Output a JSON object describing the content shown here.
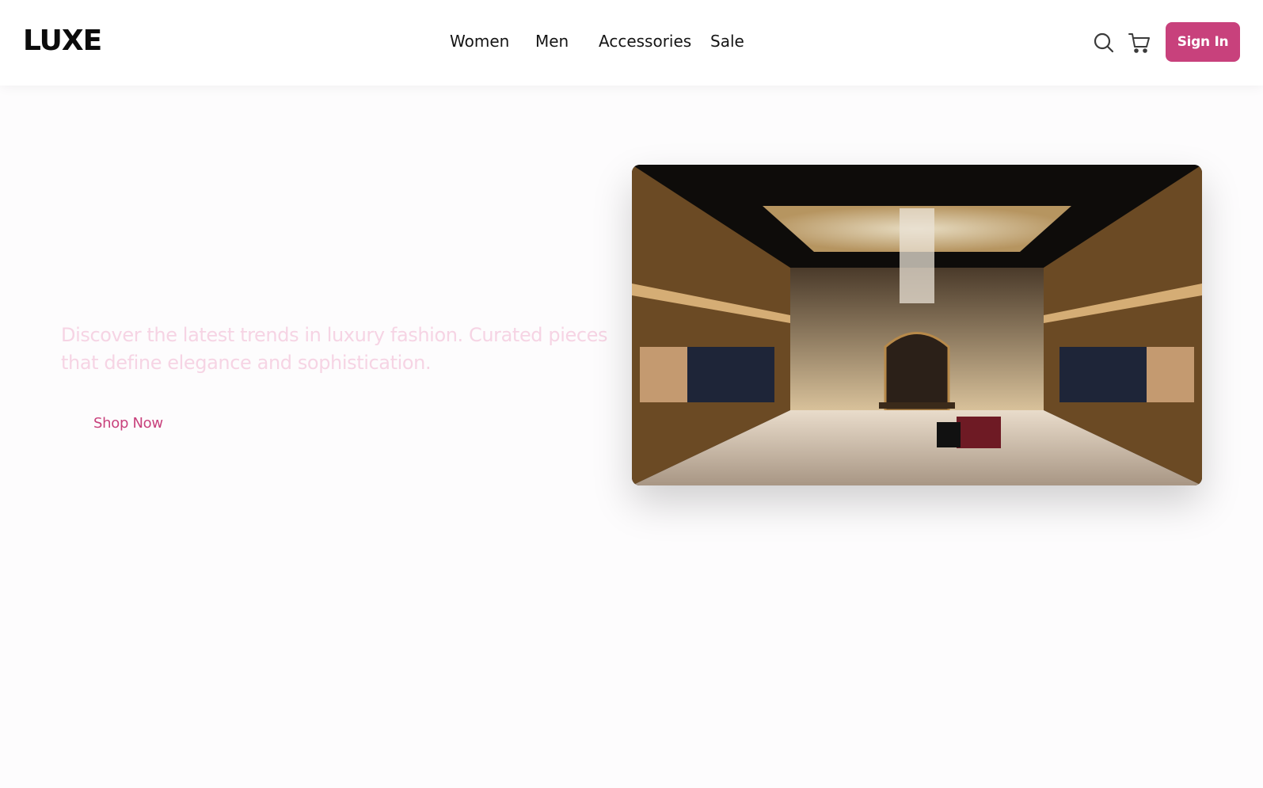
{
  "brand": {
    "logo": "LUXE",
    "accent_color": "#c8417c"
  },
  "nav": {
    "links": [
      {
        "label": "Women"
      },
      {
        "label": "Men"
      },
      {
        "label": "Accessories"
      },
      {
        "label": "Sale"
      }
    ],
    "search_icon": "search-icon",
    "cart_icon": "cart-icon",
    "signin_label": "Sign In"
  },
  "hero": {
    "subtitle": "Discover the latest trends in luxury fashion. Curated pieces that define elegance and sophistication.",
    "cta_label": "Shop Now",
    "image_icon": "luxury-store-interior-image"
  }
}
